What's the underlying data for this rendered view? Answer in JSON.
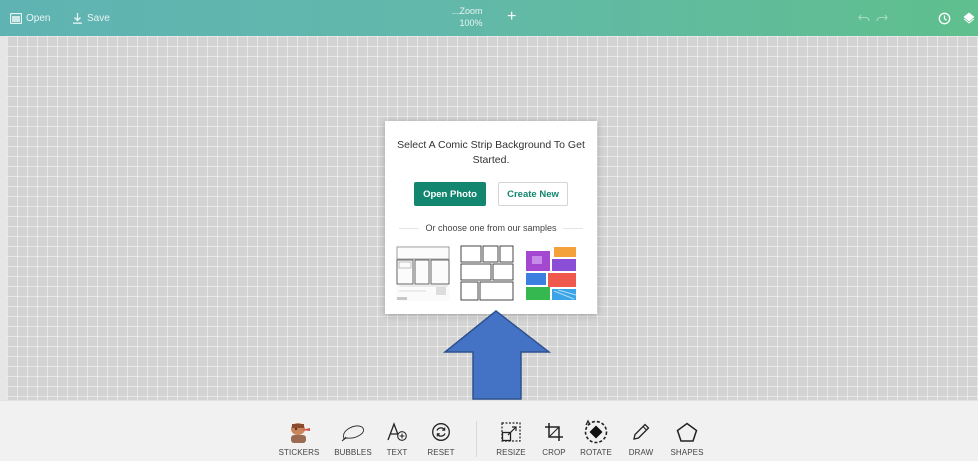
{
  "topbar": {
    "open_label": "Open",
    "save_label": "Save",
    "zoom_label": "Zoom",
    "zoom_value": "100%",
    "icons": [
      "folder-icon",
      "download-icon",
      "zoom-plus-icon",
      "undo-icon",
      "redo-icon",
      "history-icon",
      "layers-icon"
    ]
  },
  "dialog": {
    "title": "Select A Comic Strip Background To Get Started.",
    "open_photo_label": "Open Photo",
    "create_new_label": "Create New",
    "samples_label": "Or choose one from our samples"
  },
  "bottombar": {
    "tools_left": [
      {
        "label": "STICKERS",
        "icon": "sticker-icon"
      },
      {
        "label": "BUBBLES",
        "icon": "speech-bubble-icon"
      },
      {
        "label": "TEXT",
        "icon": "text-add-icon"
      },
      {
        "label": "RESET",
        "icon": "reset-icon"
      }
    ],
    "tools_right": [
      {
        "label": "RESIZE",
        "icon": "resize-icon"
      },
      {
        "label": "CROP",
        "icon": "crop-icon"
      },
      {
        "label": "ROTATE",
        "icon": "rotate-icon"
      },
      {
        "label": "DRAW",
        "icon": "pencil-icon"
      },
      {
        "label": "SHAPES",
        "icon": "pentagon-icon"
      }
    ]
  },
  "colors": {
    "accent": "#13866f",
    "topbar_start": "#5fb3b3",
    "topbar_end": "#5fbf8d",
    "canvas": "#d3d3d3",
    "arrow": "#4472c4"
  }
}
